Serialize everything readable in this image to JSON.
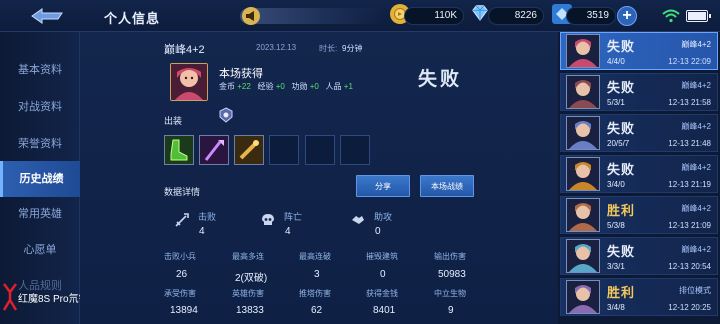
{
  "header": {
    "title": "个人信息",
    "gold": "110K",
    "diamonds": "8226",
    "vouchers": "3519",
    "plus_label": "+"
  },
  "sidebar": {
    "items": [
      {
        "label": "基本资料"
      },
      {
        "label": "对战资料"
      },
      {
        "label": "荣誉资料"
      },
      {
        "label": "历史战绩"
      },
      {
        "label": "常用英雄"
      },
      {
        "label": "心愿单"
      },
      {
        "label": "人品规则"
      }
    ],
    "active_index": 3
  },
  "watermark": "红魔8S Pro氘锋透明版",
  "match": {
    "mode": "巅峰4+2",
    "date": "2023.12.13",
    "duration_label": "时长:",
    "duration": "9分钟",
    "result": "失败",
    "reward_title": "本场获得",
    "rewards": [
      {
        "label": "金币",
        "value": "+22"
      },
      {
        "label": "经验",
        "value": "+0"
      },
      {
        "label": "功勋",
        "value": "+0"
      },
      {
        "label": "人品",
        "value": "+1"
      }
    ],
    "equip_label": "出装",
    "data_label": "数据详情",
    "share_button": "分享",
    "battle_button": "本场战绩",
    "kda": [
      {
        "label": "击败",
        "value": "4",
        "icon": "sword-icon"
      },
      {
        "label": "阵亡",
        "value": "4",
        "icon": "skull-icon"
      },
      {
        "label": "助攻",
        "value": "0",
        "icon": "handshake-icon"
      }
    ],
    "stats_row1": [
      {
        "label": "击败小兵",
        "value": "26"
      },
      {
        "label": "最高多连",
        "value": "2(双破)"
      },
      {
        "label": "最高连破",
        "value": "3"
      },
      {
        "label": "摧毁建筑",
        "value": "0"
      },
      {
        "label": "输出伤害",
        "value": "50983"
      }
    ],
    "stats_row2": [
      {
        "label": "承受伤害",
        "value": "13894"
      },
      {
        "label": "英雄伤害",
        "value": "13833"
      },
      {
        "label": "推塔伤害",
        "value": "62"
      },
      {
        "label": "获得金钱",
        "value": "8401"
      },
      {
        "label": "中立生物",
        "value": "9"
      }
    ]
  },
  "history": [
    {
      "result": "失败",
      "outcome": "lose",
      "mode": "巅峰4+2",
      "kda": "4/4/0",
      "time": "12-13 22:09",
      "active": true,
      "hero_color": "#c94a6e"
    },
    {
      "result": "失败",
      "outcome": "lose",
      "mode": "巅峰4+2",
      "kda": "5/3/1",
      "time": "12-13 21:58",
      "active": false,
      "hero_color": "#8a4a52"
    },
    {
      "result": "失败",
      "outcome": "lose",
      "mode": "巅峰4+2",
      "kda": "20/5/7",
      "time": "12-13 21:48",
      "active": false,
      "hero_color": "#6a7ec8"
    },
    {
      "result": "失败",
      "outcome": "lose",
      "mode": "巅峰4+2",
      "kda": "3/4/0",
      "time": "12-13 21:19",
      "active": false,
      "hero_color": "#c8862a"
    },
    {
      "result": "胜利",
      "outcome": "win",
      "mode": "巅峰4+2",
      "kda": "5/3/8",
      "time": "12-13 21:09",
      "active": false,
      "hero_color": "#b06a4a"
    },
    {
      "result": "失败",
      "outcome": "lose",
      "mode": "巅峰4+2",
      "kda": "3/3/1",
      "time": "12-13 20:54",
      "active": false,
      "hero_color": "#5aa6c8"
    },
    {
      "result": "胜利",
      "outcome": "win",
      "mode": "排位模式",
      "kda": "3/4/8",
      "time": "12-12 20:25",
      "active": false,
      "hero_color": "#8a6ab0"
    }
  ]
}
